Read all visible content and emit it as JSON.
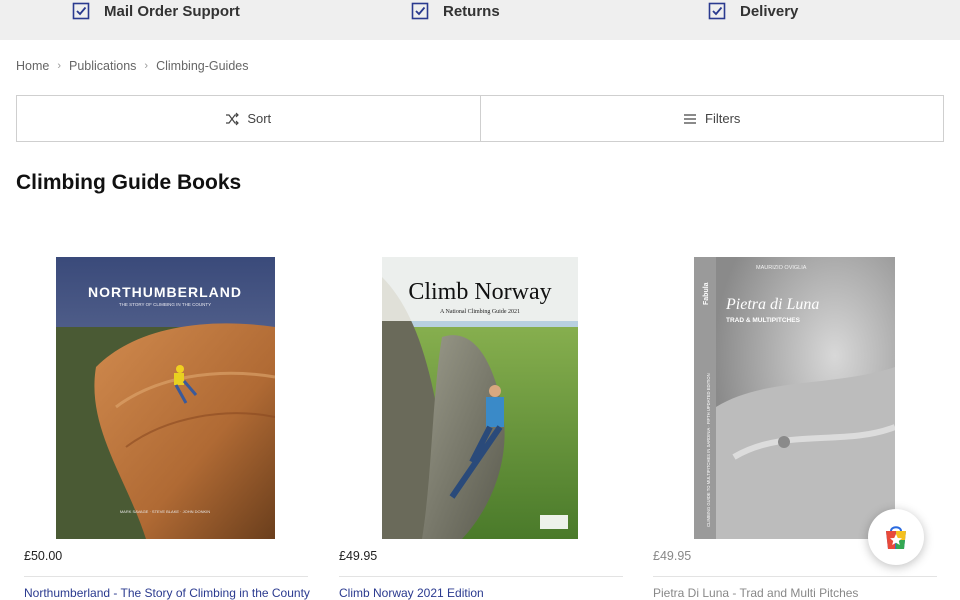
{
  "usp_bar": {
    "items": [
      {
        "label": "Mail Order Support"
      },
      {
        "label": "Returns"
      },
      {
        "label": "Delivery"
      }
    ]
  },
  "breadcrumb": {
    "items": [
      "Home",
      "Publications",
      "Climbing-Guides"
    ]
  },
  "toolbar": {
    "sort_label": "Sort",
    "filters_label": "Filters"
  },
  "page": {
    "title": "Climbing Guide Books"
  },
  "products": [
    {
      "price": "£50.00",
      "name": "Northumberland - The Story of Climbing in the County",
      "cover_title": "NORTHUMBERLAND",
      "cover_subtitle": "THE STORY OF CLIMBING IN THE COUNTY",
      "cover_credits": "MARK SAVAGE · STEVE BLAKE · JOHN DONKIN"
    },
    {
      "price": "£49.95",
      "name": "Climb Norway 2021 Edition",
      "cover_title": "Climb Norway",
      "cover_subtitle": "A National Climbing Guide 2021"
    },
    {
      "price": "£49.95",
      "name": "Pietra Di Luna - Trad and Multi Pitches",
      "cover_author": "MAURIZIO OVIGLIA",
      "cover_title": "Pietra di Luna",
      "cover_subtitle": "TRAD & MULTIPITCHES",
      "cover_publisher": "Fabula",
      "cover_spine": "CLIMBING GUIDE TO MULTIPITCHES IN SARDINIA · FIFTH UPDATED EDITION"
    }
  ],
  "colors": {
    "accent": "#2a3a8f",
    "topbar_bg": "#efefef",
    "border": "#cfcfcf"
  }
}
